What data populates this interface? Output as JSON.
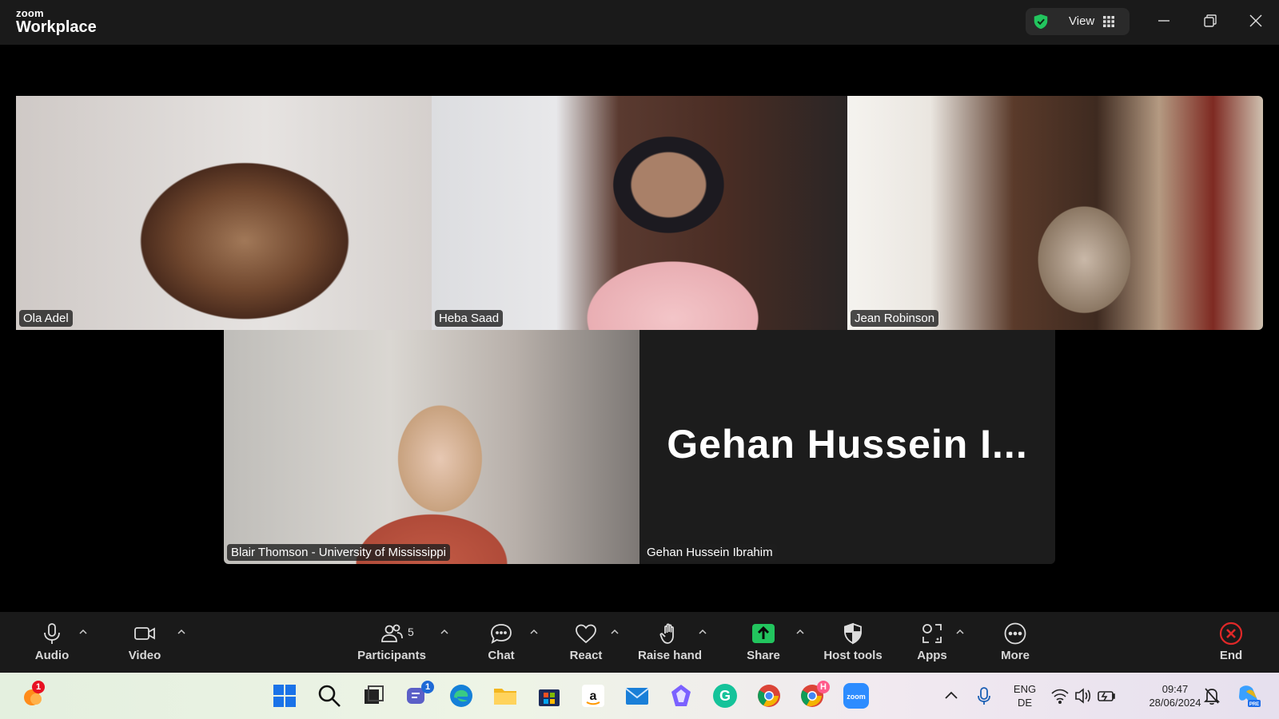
{
  "app": {
    "logo_small": "zoom",
    "logo_big": "Workplace",
    "view_label": "View"
  },
  "participants": [
    {
      "name": "Ola Adel",
      "active_speaker": true
    },
    {
      "name": "Heba Saad"
    },
    {
      "name": "Jean Robinson"
    },
    {
      "name": "Blair Thomson - University of Mississippi"
    },
    {
      "name": "Gehan Hussein Ibrahim",
      "display_text": "Gehan  Hussein  I..."
    }
  ],
  "toolbar": {
    "audio": "Audio",
    "video": "Video",
    "participants": "Participants",
    "participants_count": "5",
    "chat": "Chat",
    "react": "React",
    "raise_hand": "Raise hand",
    "share": "Share",
    "host_tools": "Host tools",
    "apps": "Apps",
    "more": "More",
    "end": "End"
  },
  "taskbar": {
    "weather_badge": "1",
    "teams_badge": "1",
    "chrome_profile_badge": "H",
    "lang_line1": "ENG",
    "lang_line2": "DE",
    "time": "09:47",
    "date": "28/06/2024"
  },
  "colors": {
    "active_speaker_border": "#23d96b",
    "share_green": "#22c55e",
    "end_red": "#e02828",
    "toolbar_bg": "#1a1a1a"
  }
}
